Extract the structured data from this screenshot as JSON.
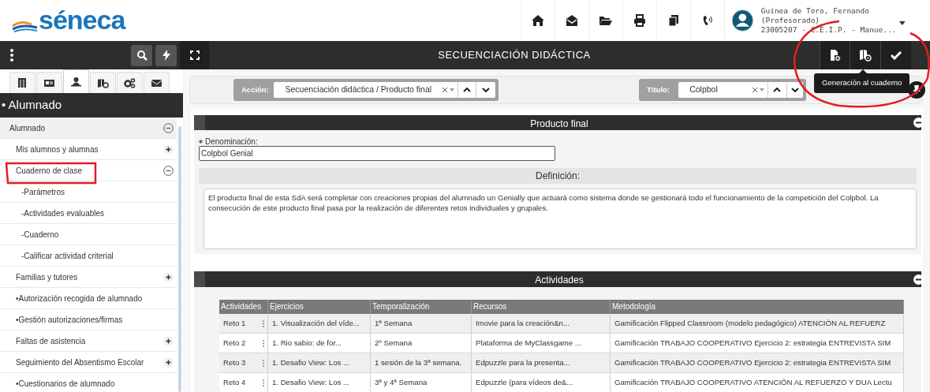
{
  "header": {
    "logo": "séneca",
    "user": {
      "name": "Guinea de Toro, Fernando",
      "role": "(Profesorado)",
      "center": "23005207 - C.E.I.P. - Manue..."
    }
  },
  "sidebar": {
    "tabs": [
      {
        "selected": false
      },
      {
        "selected": false
      },
      {
        "selected": true
      },
      {
        "selected": false
      },
      {
        "selected": false
      },
      {
        "selected": false
      }
    ],
    "section_title": "• Alumnado",
    "items": [
      {
        "kind": "group",
        "label": "Alumnado",
        "expanded": true,
        "children": [
          {
            "kind": "group",
            "label": "Mis alumnos y alumnas",
            "expanded": false
          },
          {
            "kind": "group",
            "label": "Cuaderno de clase",
            "expanded": true,
            "children": [
              {
                "kind": "link",
                "label": "-Parámetros"
              },
              {
                "kind": "link",
                "label": "-Actividades evaluables"
              },
              {
                "kind": "link",
                "label": "-Cuaderno"
              },
              {
                "kind": "link",
                "label": "-Calificar actividad criterial"
              }
            ]
          },
          {
            "kind": "group",
            "label": "Familias y tutores",
            "expanded": false
          },
          {
            "kind": "link",
            "label": "•Autorización recogida de alumnado"
          },
          {
            "kind": "link",
            "label": "•Gestión autorizaciones/firmas"
          },
          {
            "kind": "group",
            "label": "Faltas de asistencia",
            "expanded": false
          },
          {
            "kind": "group",
            "label": "Seguimiento del Absentismo Escolar",
            "expanded": false
          },
          {
            "kind": "link",
            "label": "•Cuestionarios de alumnado"
          }
        ]
      }
    ]
  },
  "page_title": "SECUENCIACIÓN DIDÁCTICA",
  "tooltip": "Generación al cuaderno",
  "filters": [
    {
      "label": "Acción:",
      "value": "Secuenciación didáctica / Producto final"
    },
    {
      "label": "Título:",
      "value": "Colpbol"
    }
  ],
  "producto_final": {
    "title": "Producto final",
    "field_label": "Denominación:",
    "required": true,
    "field_value": "Colpbol Genial",
    "definition_label": "Definición:",
    "definition_text": "El producto final de esta SdA será completar con creaciones propias del alumnado un Genially que actuará como sistema donde se gestionará todo el funcionamiento de la competición del Colpbol. La consecución de este producto final pasa por la realización de diferentes retos individuales y grupales."
  },
  "actividades": {
    "title": "Actividades",
    "table": {
      "columns": [
        "Actividades",
        "Ejercicios",
        "Temporalización",
        "Recursos",
        "Metodología"
      ],
      "rows": [
        [
          "Reto 1",
          "1. Visualización del víde...",
          "1ª Semana",
          "Imovie para la creación&n...",
          "Gamificación Flipped Classroom (modelo pedagógico) ATENCIÓN AL REFUERZ"
        ],
        [
          "Reto 2",
          "1. Rio sabio: de for...",
          "2º Semana",
          "Plataforma de MyClassgame ...",
          "Gamificación TRABAJO COOPERATIVO Ejercicio 2: estrategia ENTREVISTA SIM"
        ],
        [
          "Reto 3",
          "1. Desafio View: Los ...",
          "1 sesión de la 3ª semana.",
          "Edpuzzle para la presenta...",
          "Gamificación TRABAJO COOPERATIVO Ejercicio 2: estrategia ENTREVISTA SIM"
        ],
        [
          "Reto 4",
          "1. Desafio View: Los ...",
          "3ª y 4ª Semana",
          "Edpuzzle (para vídeos de&...",
          "Gamificación TRABAJO COOPERATIVO ATENCIÓN AL REFUERZO Y DUA Lectu"
        ]
      ]
    }
  }
}
